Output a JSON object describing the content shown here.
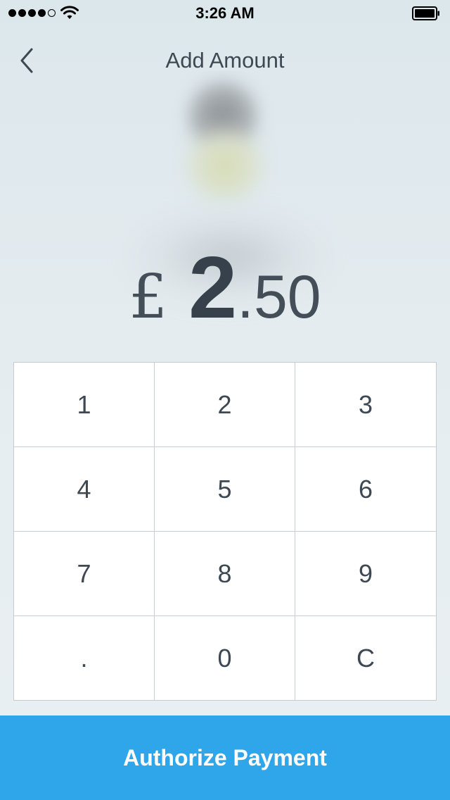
{
  "status_bar": {
    "time": "3:26 AM",
    "signal_filled": 4,
    "signal_total": 5,
    "signal_icon": "cellular-signal-icon",
    "wifi_icon": "wifi-icon",
    "battery_icon": "battery-icon",
    "battery_level": 0.9
  },
  "nav": {
    "title": "Add Amount",
    "back_icon": "chevron-left-icon"
  },
  "amount": {
    "currency_symbol": "£",
    "whole": "2",
    "decimal_point": ".",
    "fraction": "50"
  },
  "keypad": {
    "keys": [
      [
        "1",
        "2",
        "3"
      ],
      [
        "4",
        "5",
        "6"
      ],
      [
        "7",
        "8",
        "9"
      ],
      [
        ".",
        "0",
        "C"
      ]
    ]
  },
  "primary_action": {
    "label": "Authorize Payment"
  },
  "colors": {
    "accent": "#2fa5ea",
    "text": "#3d4852",
    "background": "#e3ebef",
    "keypad_border": "#c8ced2"
  }
}
